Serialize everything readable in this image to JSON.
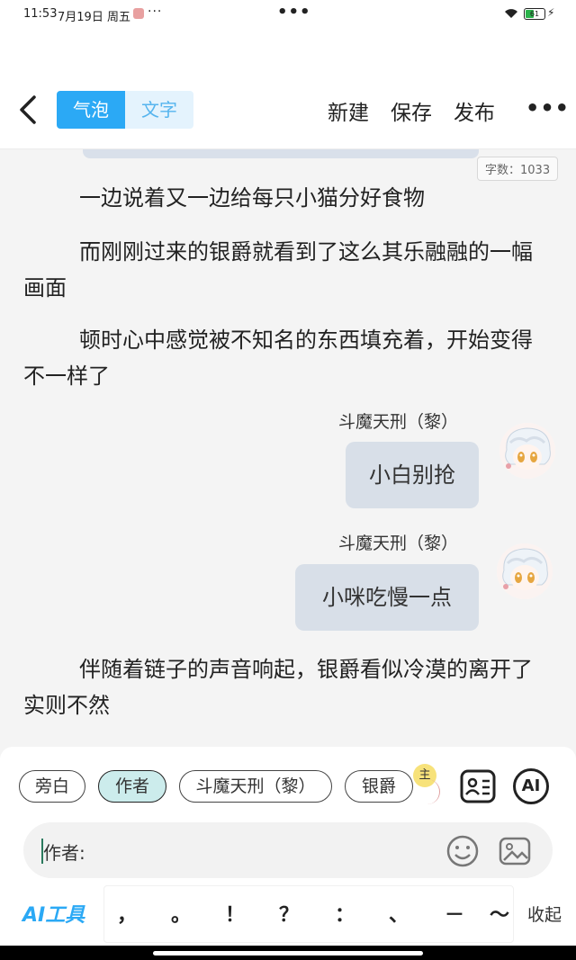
{
  "status": {
    "time": "11:53",
    "date": "7月19日 周五",
    "more_dots": "···",
    "center_dots": "•••",
    "battery": "61"
  },
  "header": {
    "tabs": [
      {
        "label": "气泡",
        "active": true
      },
      {
        "label": "文字",
        "active": false
      }
    ],
    "actions": [
      "新建",
      "保存",
      "发布"
    ],
    "more": "•••"
  },
  "content": {
    "word_count": "字数：1033",
    "paragraphs": [
      "一边说着又一边给每只小猫分好食物",
      "而刚刚过来的银爵就看到了这么其乐融融的一幅画面",
      "顿时心中感觉被不知名的东西填充着，开始变得不一样了",
      "伴随着链子的声音响起，银爵看似冷漠的离开了实则不然"
    ],
    "messages": [
      {
        "speaker": "斗魔天刑（黎）",
        "text": "小白别抢"
      },
      {
        "speaker": "斗魔天刑（黎）",
        "text": "小咪吃慢一点"
      }
    ]
  },
  "composer": {
    "roles": [
      "旁白",
      "作者",
      "斗魔天刑（黎）",
      "银爵"
    ],
    "selected_role": "作者",
    "badge": "主",
    "role_card_icon": "contact-card-icon",
    "ai_button": "AI",
    "input_value": "作者:",
    "ai_tool": "AI工具",
    "punctuation": [
      "，",
      "。",
      "！",
      "？",
      "：",
      "、",
      "－",
      "～"
    ],
    "collapse": "收起"
  },
  "colors": {
    "accent": "#2ba9f5",
    "bubble": "#d8dfe8",
    "selected_chip": "#ccecec"
  }
}
